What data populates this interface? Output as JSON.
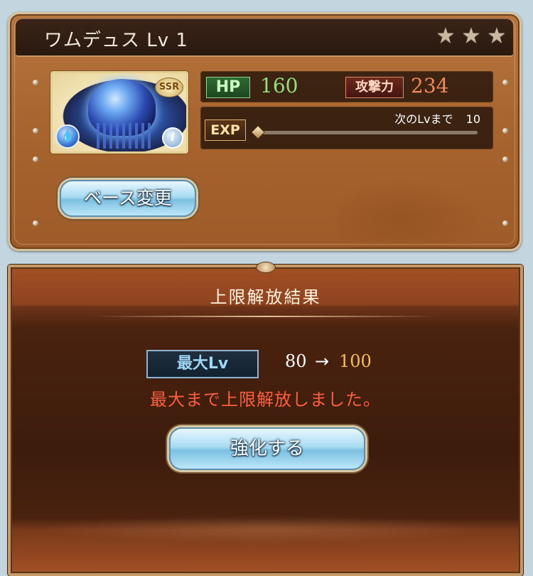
{
  "character": {
    "name": "ワムデュス Lv 1",
    "rarity": "SSR",
    "stars": [
      "★",
      "★",
      "★"
    ],
    "element_icon": "water-icon"
  },
  "stats": {
    "hp_label": "HP",
    "hp_value": "160",
    "atk_label": "攻撃力",
    "atk_value": "234",
    "exp_label": "EXP",
    "next_lv_label": "次のLvまで",
    "next_lv_value": "10",
    "exp_progress": 0.0
  },
  "buttons": {
    "base_change": "ベース変更",
    "enhance": "強化する"
  },
  "result": {
    "title": "上限解放結果",
    "max_lv_label": "最大Lv",
    "max_lv_from": "80",
    "arrow": "→",
    "max_lv_to": "100",
    "message": "最大まで上限解放しました。"
  },
  "colors": {
    "hp_value": "#8fe17e",
    "atk_value": "#f3895b",
    "max_lv_to": "#f3c052",
    "message": "#ff5f3d"
  }
}
